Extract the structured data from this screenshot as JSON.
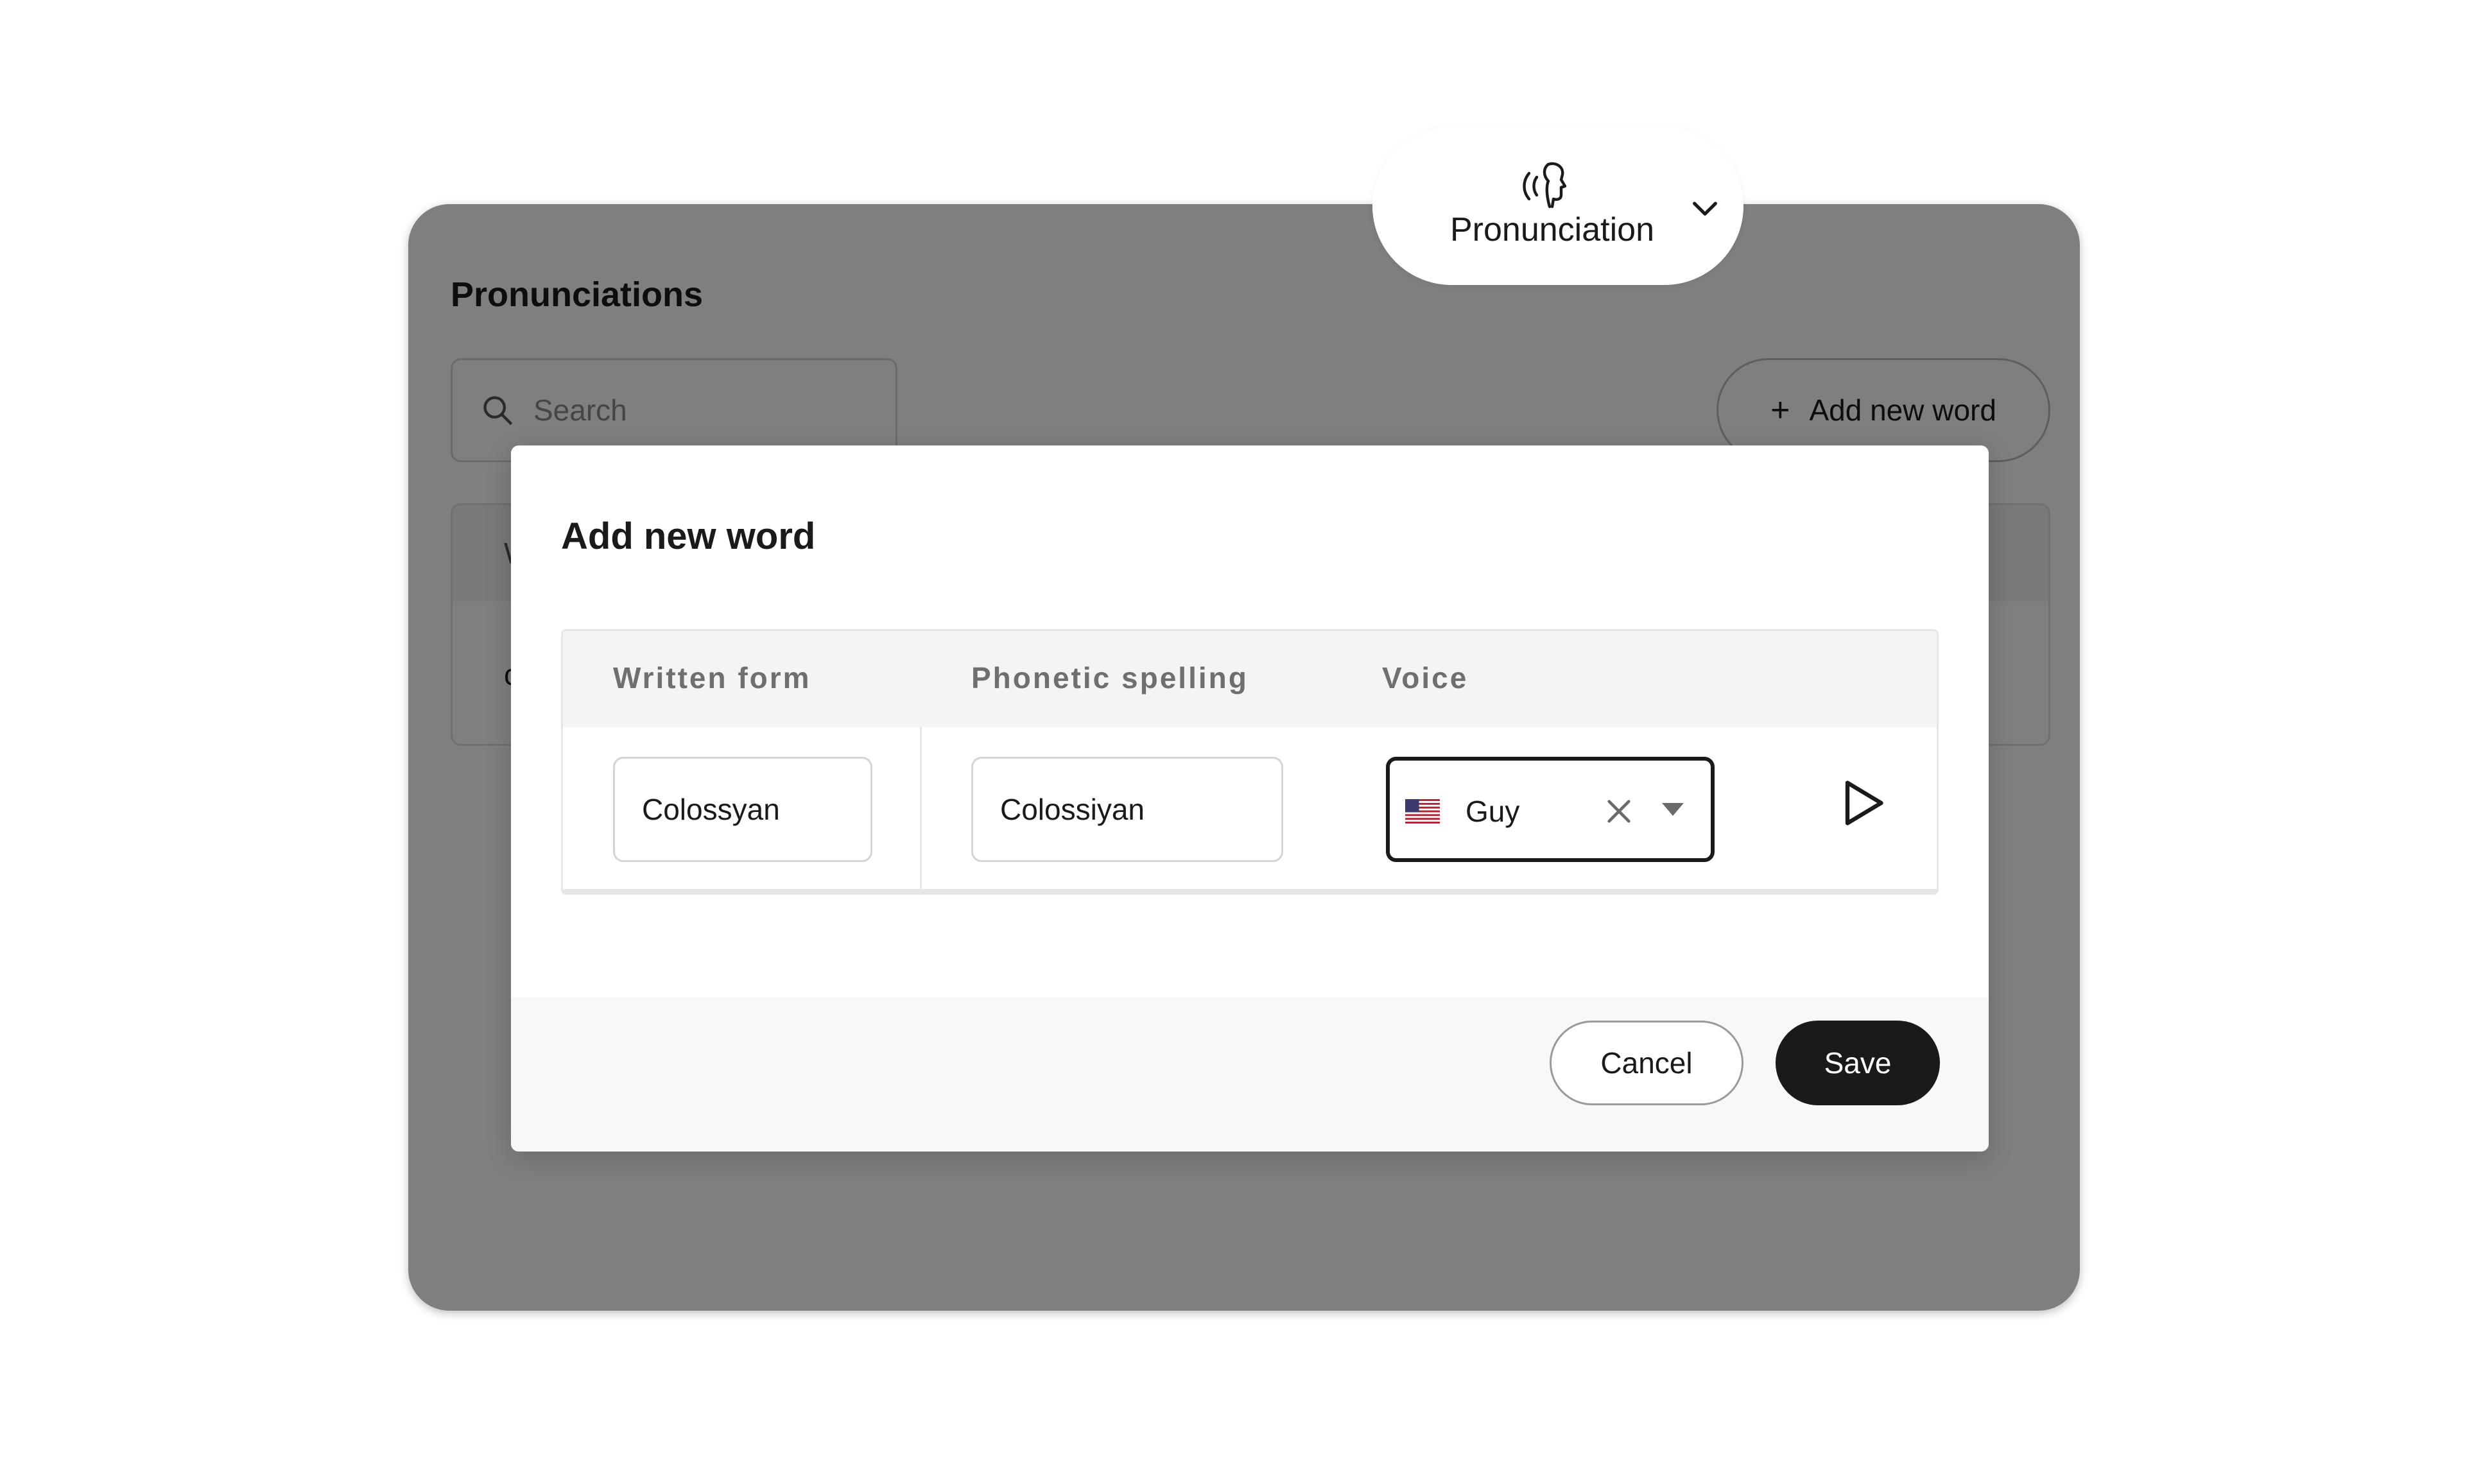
{
  "background_page": {
    "title": "Pronunciations",
    "search": {
      "placeholder": "Search"
    },
    "add_button": {
      "icon": "plus-icon",
      "label": "Add new word"
    },
    "table_header_initial": "W",
    "table_row_initial": "c"
  },
  "pronunciation_menu": {
    "icon": "speaking-head-icon",
    "label": "Pronunciation",
    "chevron": "chevron-down-icon"
  },
  "modal": {
    "title": "Add new word",
    "columns": [
      "Written form",
      "Phonetic spelling",
      "Voice"
    ],
    "row": {
      "written_form": "Colossyan",
      "phonetic_spelling": "Colossiyan",
      "voice": {
        "flag": "us-flag-icon",
        "name": "Guy"
      },
      "play_icon": "play-icon"
    },
    "buttons": {
      "cancel": "Cancel",
      "save": "Save"
    }
  },
  "colors": {
    "overlay": "#000000",
    "primary_button": "#1a1a1a",
    "header_bg": "#f4f4f4",
    "footer_bg": "#f8f8f8"
  }
}
